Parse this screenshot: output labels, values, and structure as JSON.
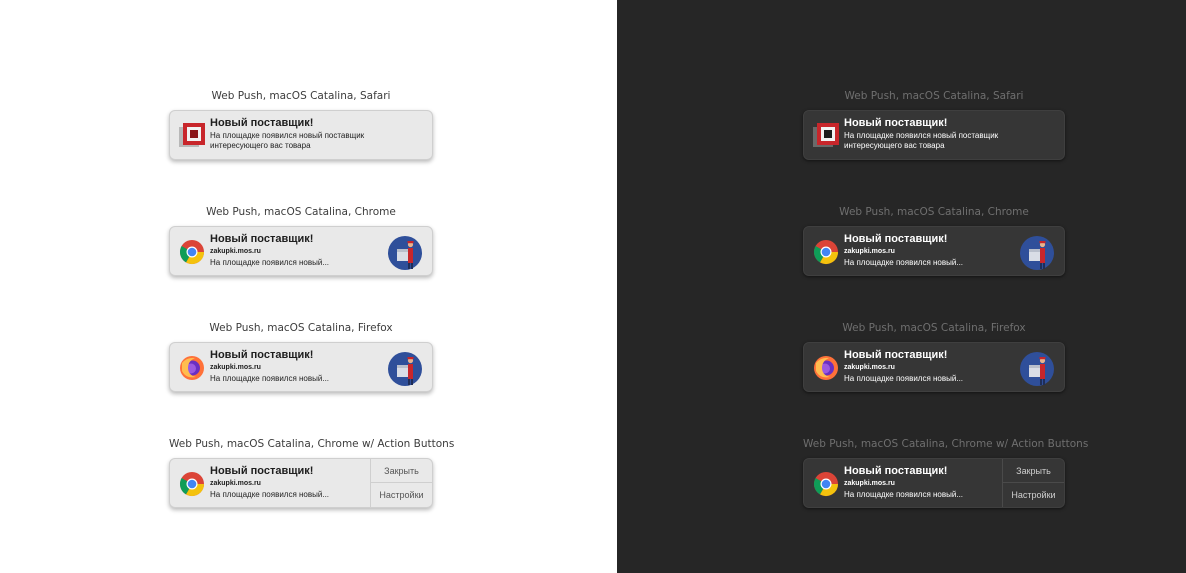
{
  "captions": {
    "safari": "Web Push, macOS Catalina, Safari",
    "chrome": "Web Push, macOS Catalina, Chrome",
    "firefox": "Web Push, macOS Catalina, Firefox",
    "chrome_actions": "Web Push, macOS Catalina, Chrome w/ Action Buttons"
  },
  "notification": {
    "title": "Новый поставщик!",
    "site": "zakupki.mos.ru",
    "body_full": "На площадке появился новый поставщик интересующего вас товара",
    "body_truncated": "На площадке появился новый..."
  },
  "actions": {
    "close": "Закрыть",
    "settings": "Настройки"
  },
  "icons": {
    "safari": "site-logo-icon",
    "chrome": "chrome-icon",
    "firefox": "firefox-icon",
    "avatar": "courier-avatar-icon"
  },
  "theme": {
    "light_background": "#ffffff",
    "dark_background": "#262626",
    "brand_red": "#c8262b"
  }
}
